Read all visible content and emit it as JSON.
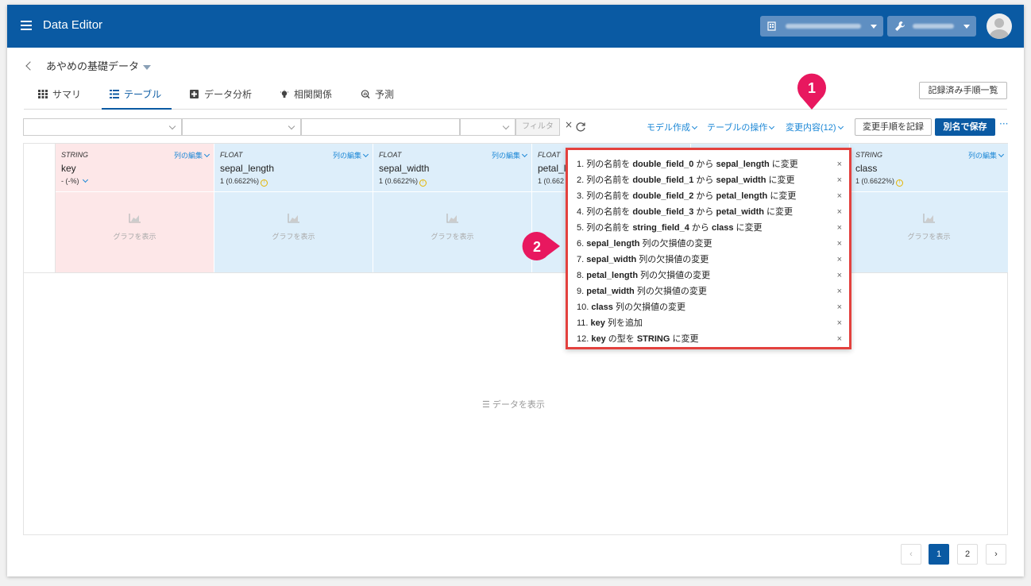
{
  "header": {
    "app_title": "Data Editor",
    "org_icon": "building-icon",
    "tool_icon": "wrench-icon"
  },
  "breadcrumb": {
    "dataset_name": "あやめの基礎データ"
  },
  "tabs": [
    {
      "label": "サマリ",
      "icon": "grid-icon"
    },
    {
      "label": "テーブル",
      "icon": "table-icon"
    },
    {
      "label": "データ分析",
      "icon": "plus-box-icon"
    },
    {
      "label": "相関関係",
      "icon": "lightbulb-icon"
    },
    {
      "label": "予測",
      "icon": "chart-search-icon"
    }
  ],
  "toolbar": {
    "recorded_steps_label": "記録済み手順一覧",
    "filter_label": "フィルタ",
    "clear": "×",
    "model_create": "モデル作成",
    "table_ops": "テーブルの操作",
    "changes": "変更内容(12)",
    "record_steps": "変更手順を記録",
    "save_as": "別名で保存",
    "more": "···"
  },
  "columns": [
    {
      "type": "STRING",
      "name": "key",
      "stat": "- (-%)",
      "edit": "列の編集",
      "graph": "グラフを表示",
      "color": "#fde7e8"
    },
    {
      "type": "FLOAT",
      "name": "sepal_length",
      "stat": "1 (0.6622%)",
      "edit": "列の編集",
      "graph": "グラフを表示",
      "color": "#ddeefa"
    },
    {
      "type": "FLOAT",
      "name": "sepal_width",
      "stat": "1 (0.6622%)",
      "edit": "列の編集",
      "graph": "グラフを表示",
      "color": "#ddeefa"
    },
    {
      "type": "FLOAT",
      "name": "petal_l",
      "stat": "1 (0.662",
      "edit": "",
      "graph": "",
      "color": "#ddeefa"
    },
    {
      "type": "STRING",
      "name": "class",
      "stat": "1 (0.6622%)",
      "edit": "列の編集",
      "graph": "グラフを表示",
      "color": "#ddeefa"
    }
  ],
  "show_data_label": "☰ データを表示",
  "changes_list": [
    {
      "n": "1.",
      "a": "列の名前を ",
      "b": "double_field_0",
      "c": " から ",
      "d": "sepal_length",
      "e": " に変更"
    },
    {
      "n": "2.",
      "a": "列の名前を ",
      "b": "double_field_1",
      "c": " から ",
      "d": "sepal_width",
      "e": " に変更"
    },
    {
      "n": "3.",
      "a": "列の名前を ",
      "b": "double_field_2",
      "c": " から ",
      "d": "petal_length",
      "e": " に変更"
    },
    {
      "n": "4.",
      "a": "列の名前を ",
      "b": "double_field_3",
      "c": " から ",
      "d": "petal_width",
      "e": " に変更"
    },
    {
      "n": "5.",
      "a": "列の名前を ",
      "b": "string_field_4",
      "c": " から ",
      "d": "class",
      "e": " に変更"
    },
    {
      "n": "6.",
      "a": "",
      "b": "sepal_length",
      "c": " 列の欠損値の変更",
      "d": "",
      "e": ""
    },
    {
      "n": "7.",
      "a": "",
      "b": "sepal_width",
      "c": " 列の欠損値の変更",
      "d": "",
      "e": ""
    },
    {
      "n": "8.",
      "a": "",
      "b": "petal_length",
      "c": " 列の欠損値の変更",
      "d": "",
      "e": ""
    },
    {
      "n": "9.",
      "a": "",
      "b": "petal_width",
      "c": " 列の欠損値の変更",
      "d": "",
      "e": ""
    },
    {
      "n": "10.",
      "a": "",
      "b": "class",
      "c": " 列の欠損値の変更",
      "d": "",
      "e": ""
    },
    {
      "n": "11.",
      "a": "",
      "b": "key",
      "c": " 列を追加",
      "d": "",
      "e": ""
    },
    {
      "n": "12.",
      "a": "",
      "b": "key",
      "c": " の型を ",
      "d": "STRING",
      "e": " に変更"
    }
  ],
  "remove_glyph": "×",
  "callouts": [
    "1",
    "2"
  ],
  "pagination": {
    "prev": "‹",
    "pages": [
      "1",
      "2"
    ],
    "next": "›",
    "current": "1"
  },
  "colors": {
    "brand": "#0a5aa3",
    "link": "#1b87d6",
    "highlight": "#e3413e",
    "callout": "#e8185f"
  }
}
